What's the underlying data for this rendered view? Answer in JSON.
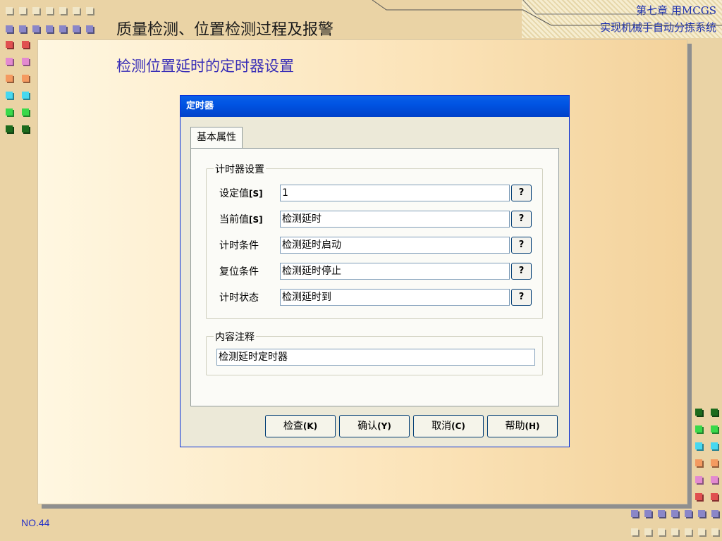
{
  "slide": {
    "title": "质量检测、位置检测过程及报警",
    "subtitle": "检测位置延时的定时器设置",
    "chapter_line1": "第七章 用MCGS",
    "chapter_line2": "实现机械手自动分拣系统",
    "page_number": "NO.44"
  },
  "dialog": {
    "title": "定时器",
    "tab": "基本属性",
    "timer_group": {
      "legend": "计时器设置",
      "rows": [
        {
          "label": "设定值",
          "suffix": "[S]",
          "value": "1",
          "help": "?"
        },
        {
          "label": "当前值",
          "suffix": "[S]",
          "value": "检测延时",
          "help": "?"
        },
        {
          "label": "计时条件",
          "suffix": "",
          "value": "检测延时启动",
          "help": "?"
        },
        {
          "label": "复位条件",
          "suffix": "",
          "value": "检测延时停止",
          "help": "?"
        },
        {
          "label": "计时状态",
          "suffix": "",
          "value": "检测延时到",
          "help": "?"
        }
      ]
    },
    "comment_group": {
      "legend": "内容注释",
      "value": "检测延时定时器"
    },
    "buttons": {
      "check": {
        "label": "检查",
        "key": "(K)"
      },
      "ok": {
        "label": "确认",
        "key": "(Y)"
      },
      "cancel": {
        "label": "取消",
        "key": "(C)"
      },
      "help": {
        "label": "帮助",
        "key": "(H)"
      }
    }
  },
  "colors": {
    "slide_background": "#ead3a5",
    "title_text": "#1b1b1b",
    "subtitle_text": "#3a2fb7",
    "chapter_text": "#1b2fb0",
    "titlebar_blue": "#0054e3",
    "dialog_face": "#ece9d8"
  }
}
